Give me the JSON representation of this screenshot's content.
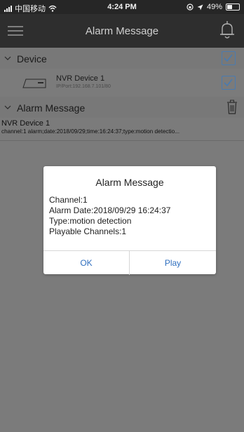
{
  "status": {
    "carrier": "中国移动",
    "time": "4:24 PM",
    "battery": "49%",
    "battery_level": 0.49
  },
  "header": {
    "title": "Alarm Message"
  },
  "device_section": {
    "label": "Device",
    "device": {
      "name": "NVR Device 1",
      "address": "IP/Port:192.168.7.101/80"
    }
  },
  "alarm_section": {
    "label": "Alarm Message",
    "item": {
      "name": "NVR Device 1",
      "detail": "channel:1  alarm;date:2018/09/29;time:16:24:37;type:motion detectio..."
    }
  },
  "dialog": {
    "title": "Alarm Message",
    "lines": [
      "Channel:1",
      "Alarm Date:2018/09/29 16:24:37",
      "Type:motion detection",
      "Playable Channels:1"
    ],
    "ok_label": "OK",
    "play_label": "Play"
  },
  "colors": {
    "accent": "#2f6fbf",
    "checkbox": "#4a7bb0",
    "overlay": "#7b7b7b",
    "header": "#2e2e2e"
  },
  "icons": [
    "signal-icon",
    "wifi-icon",
    "location-icon",
    "battery-icon",
    "menu-icon",
    "bell-icon",
    "chevron-down-icon",
    "checkbox-icon",
    "nvr-device-icon",
    "trash-icon"
  ]
}
